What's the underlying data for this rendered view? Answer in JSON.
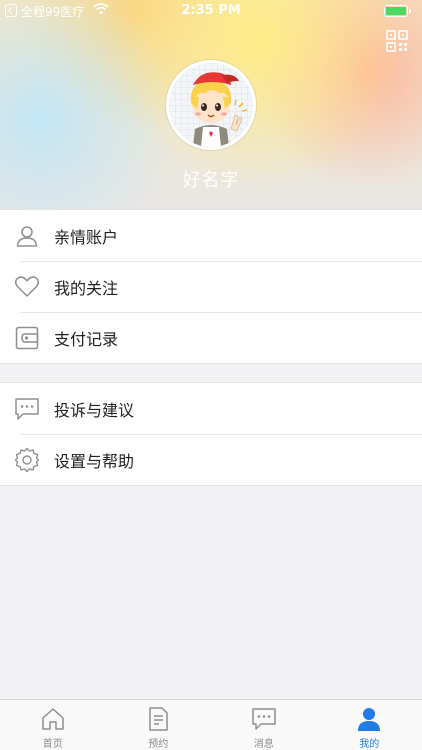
{
  "status_bar": {
    "carrier": "全程99医疗",
    "time": "2:35 PM"
  },
  "profile": {
    "username": "好名字"
  },
  "menu": {
    "group1": [
      {
        "label": "亲情账户",
        "icon": "person-icon"
      },
      {
        "label": "我的关注",
        "icon": "heart-icon"
      },
      {
        "label": "支付记录",
        "icon": "wallet-icon"
      }
    ],
    "group2": [
      {
        "label": "投诉与建议",
        "icon": "chat-bubble-icon"
      },
      {
        "label": "设置与帮助",
        "icon": "gear-icon"
      }
    ]
  },
  "tabbar": {
    "items": [
      {
        "label": "首页",
        "icon": "home-icon",
        "active": false
      },
      {
        "label": "预约",
        "icon": "document-icon",
        "active": false
      },
      {
        "label": "消息",
        "icon": "message-icon",
        "active": false
      },
      {
        "label": "我的",
        "icon": "person-icon",
        "active": true
      }
    ]
  },
  "colors": {
    "accent": "#1f7ce9",
    "battery": "#4cd964"
  }
}
